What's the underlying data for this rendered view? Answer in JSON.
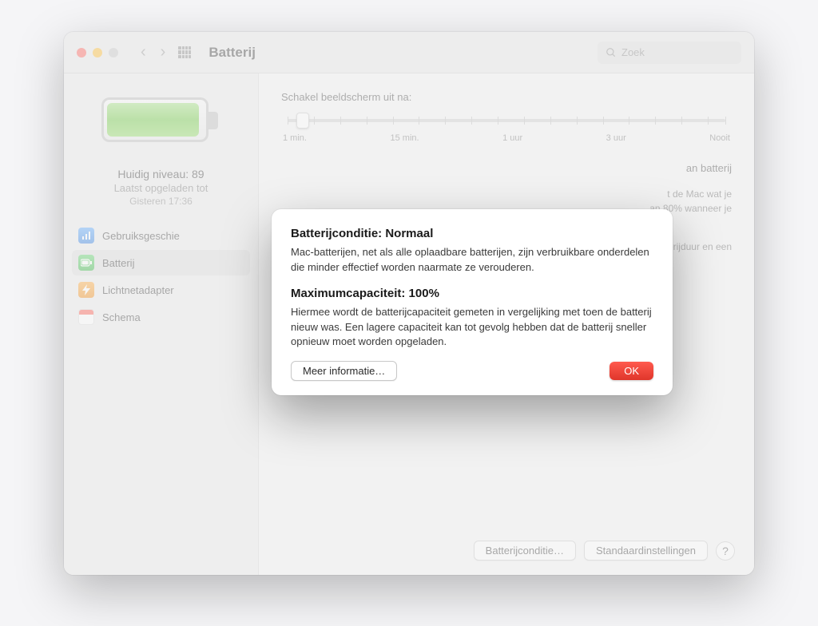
{
  "window": {
    "title": "Batterij",
    "search_placeholder": "Zoek"
  },
  "sidebar": {
    "level_line": "Huidig niveau: 89",
    "sub_line": "Laatst opgeladen tot",
    "time_line": "Gisteren 17:36",
    "items": [
      {
        "label": "Gebruiksgeschie"
      },
      {
        "label": "Batterij"
      },
      {
        "label": "Lichtnetadapter"
      },
      {
        "label": "Schema"
      }
    ]
  },
  "main": {
    "slider_label": "Schakel beeldscherm uit na:",
    "slider_values": [
      "1 min.",
      "15 min.",
      "1 uur",
      "3 uur",
      "Nooit"
    ],
    "section_heading_suffix": "an batterij",
    "info_block_line1": "t de Mac wat je",
    "info_block_line2": "an 80% wanneer je",
    "info_block2": "terijduur en een",
    "battery_condition_btn": "Batterijconditie…",
    "defaults_btn": "Standaardinstellingen",
    "help": "?"
  },
  "dialog": {
    "heading1": "Batterijconditie: Normaal",
    "para1": "Mac-batterijen, net als alle oplaadbare batterijen, zijn verbruikbare onderdelen die minder effectief worden naarmate ze verouderen.",
    "heading2": "Maximumcapaciteit: 100%",
    "para2": "Hiermee wordt de batterijcapaciteit gemeten in vergelijking met toen de batterij nieuw was. Een lagere capaciteit kan tot gevolg hebben dat de batterij sneller opnieuw moet worden opgeladen.",
    "more_info": "Meer informatie…",
    "ok": "OK"
  }
}
